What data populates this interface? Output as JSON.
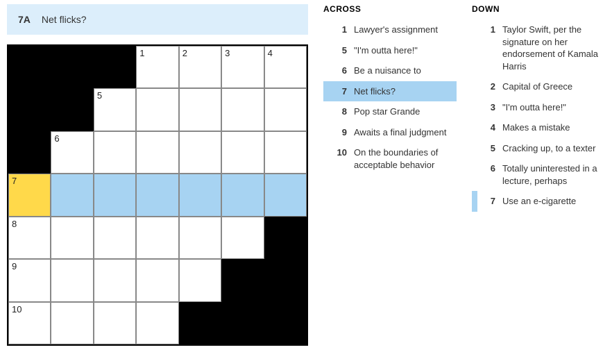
{
  "current_clue": {
    "label": "7A",
    "text": "Net flicks?"
  },
  "grid": {
    "cols": 7,
    "rows": 7,
    "cells": [
      {
        "r": 0,
        "c": 0,
        "black": true
      },
      {
        "r": 0,
        "c": 1,
        "black": true
      },
      {
        "r": 0,
        "c": 2,
        "black": true
      },
      {
        "r": 0,
        "c": 3,
        "n": "1"
      },
      {
        "r": 0,
        "c": 4,
        "n": "2"
      },
      {
        "r": 0,
        "c": 5,
        "n": "3"
      },
      {
        "r": 0,
        "c": 6,
        "n": "4"
      },
      {
        "r": 1,
        "c": 0,
        "black": true
      },
      {
        "r": 1,
        "c": 1,
        "black": true
      },
      {
        "r": 1,
        "c": 2,
        "n": "5"
      },
      {
        "r": 1,
        "c": 3
      },
      {
        "r": 1,
        "c": 4
      },
      {
        "r": 1,
        "c": 5
      },
      {
        "r": 1,
        "c": 6
      },
      {
        "r": 2,
        "c": 0,
        "black": true
      },
      {
        "r": 2,
        "c": 1,
        "n": "6"
      },
      {
        "r": 2,
        "c": 2
      },
      {
        "r": 2,
        "c": 3
      },
      {
        "r": 2,
        "c": 4
      },
      {
        "r": 2,
        "c": 5
      },
      {
        "r": 2,
        "c": 6
      },
      {
        "r": 3,
        "c": 0,
        "n": "7",
        "cursor": true
      },
      {
        "r": 3,
        "c": 1,
        "hl": true
      },
      {
        "r": 3,
        "c": 2,
        "hl": true
      },
      {
        "r": 3,
        "c": 3,
        "hl": true
      },
      {
        "r": 3,
        "c": 4,
        "hl": true
      },
      {
        "r": 3,
        "c": 5,
        "hl": true
      },
      {
        "r": 3,
        "c": 6,
        "hl": true
      },
      {
        "r": 4,
        "c": 0,
        "n": "8"
      },
      {
        "r": 4,
        "c": 1
      },
      {
        "r": 4,
        "c": 2
      },
      {
        "r": 4,
        "c": 3
      },
      {
        "r": 4,
        "c": 4
      },
      {
        "r": 4,
        "c": 5
      },
      {
        "r": 4,
        "c": 6,
        "black": true
      },
      {
        "r": 5,
        "c": 0,
        "n": "9"
      },
      {
        "r": 5,
        "c": 1
      },
      {
        "r": 5,
        "c": 2
      },
      {
        "r": 5,
        "c": 3
      },
      {
        "r": 5,
        "c": 4
      },
      {
        "r": 5,
        "c": 5,
        "black": true
      },
      {
        "r": 5,
        "c": 6,
        "black": true
      },
      {
        "r": 6,
        "c": 0,
        "n": "10"
      },
      {
        "r": 6,
        "c": 1
      },
      {
        "r": 6,
        "c": 2
      },
      {
        "r": 6,
        "c": 3
      },
      {
        "r": 6,
        "c": 4,
        "black": true
      },
      {
        "r": 6,
        "c": 5,
        "black": true
      },
      {
        "r": 6,
        "c": 6,
        "black": true
      }
    ]
  },
  "across": {
    "header": "ACROSS",
    "items": [
      {
        "n": "1",
        "t": "Lawyer's assignment"
      },
      {
        "n": "5",
        "t": "\"I'm outta here!\""
      },
      {
        "n": "6",
        "t": "Be a nuisance to"
      },
      {
        "n": "7",
        "t": "Net flicks?",
        "selected": true
      },
      {
        "n": "8",
        "t": "Pop star Grande"
      },
      {
        "n": "9",
        "t": "Awaits a final judgment"
      },
      {
        "n": "10",
        "t": "On the boundaries of acceptable behavior"
      }
    ]
  },
  "down": {
    "header": "DOWN",
    "items": [
      {
        "n": "1",
        "t": "Taylor Swift, per the signature on her endorsement of Kamala Harris"
      },
      {
        "n": "2",
        "t": "Capital of Greece"
      },
      {
        "n": "3",
        "t": "\"I'm outta here!\""
      },
      {
        "n": "4",
        "t": "Makes a mistake"
      },
      {
        "n": "5",
        "t": "Cracking up, to a texter"
      },
      {
        "n": "6",
        "t": "Totally uninterested in a lecture, perhaps"
      },
      {
        "n": "7",
        "t": "Use an e-cigarette",
        "related": true
      }
    ]
  }
}
